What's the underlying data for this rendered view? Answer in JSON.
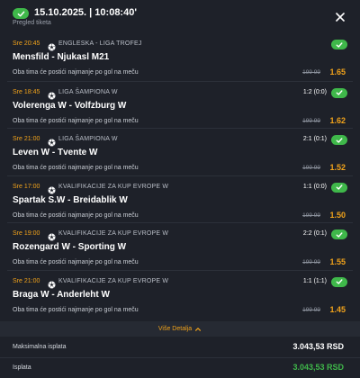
{
  "header": {
    "title": "15.10.2025. | 10:08:40'",
    "subtitle": "Pregled tiketa"
  },
  "matches": [
    {
      "time": "Sre 20:45",
      "league": "ENGLESKA - LIGA TROFEJ",
      "score": "",
      "teams": "Mensfild - Njukasl M21",
      "market": "Oba tima će postići najmanje po gol na meču",
      "code": "199 99",
      "odd": "1.65"
    },
    {
      "time": "Sre 18:45",
      "league": "LIGA ŠAMPIONA W",
      "score": "1:2 (0:0)",
      "teams": "Volerenga W - Volfzburg W",
      "market": "Oba tima će postići najmanje po gol na meču",
      "code": "199 99",
      "odd": "1.62"
    },
    {
      "time": "Sre 21:00",
      "league": "LIGA ŠAMPIONA W",
      "score": "2:1 (0:1)",
      "teams": "Leven W - Tvente W",
      "market": "Oba tima će postići najmanje po gol na meču",
      "code": "199 99",
      "odd": "1.52"
    },
    {
      "time": "Sre 17:00",
      "league": "KVALIFIKACIJE ZA KUP EVROPE W",
      "score": "1:1 (0:0)",
      "teams": "Spartak S.W - Breidablik W",
      "market": "Oba tima će postići najmanje po gol na meču",
      "code": "199 99",
      "odd": "1.50"
    },
    {
      "time": "Sre 19:00",
      "league": "KVALIFIKACIJE ZA KUP EVROPE W",
      "score": "2:2 (0:1)",
      "teams": "Rozengard W - Sporting W",
      "market": "Oba tima će postići najmanje po gol na meču",
      "code": "199 99",
      "odd": "1.55"
    },
    {
      "time": "Sre 21:00",
      "league": "KVALIFIKACIJE ZA KUP EVROPE W",
      "score": "1:1 (1:1)",
      "teams": "Braga W - Anderleht W",
      "market": "Oba tima će postići najmanje po gol na meču",
      "code": "199 99",
      "odd": "1.45"
    }
  ],
  "details_label": "Više Detalja",
  "summary": {
    "max_payout_label": "Maksimalna isplata",
    "max_payout_value": "3.043,53 RSD",
    "payout_label": "Isplata",
    "payout_value": "3.043,53 RSD"
  },
  "colors": {
    "accent": "#f0a21b",
    "success": "#3fb84a",
    "background": "#1e2129"
  },
  "icons": {
    "status": "check-icon",
    "sport": "football-icon",
    "close": "close-icon",
    "details": "chevron-up-icon"
  }
}
